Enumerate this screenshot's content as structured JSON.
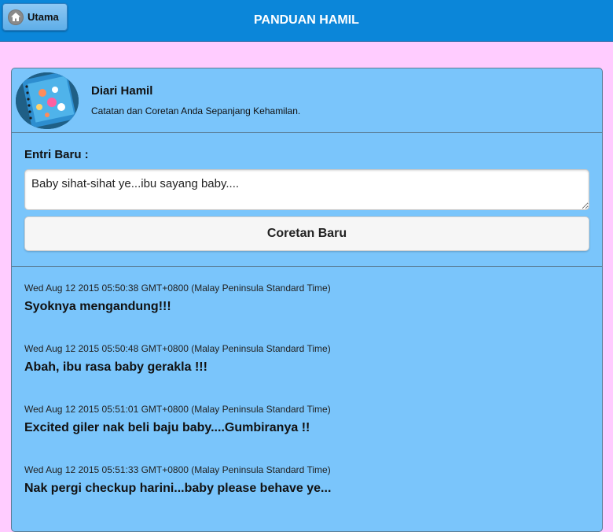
{
  "header": {
    "home_label": "Utama",
    "title": "PANDUAN HAMIL"
  },
  "diary": {
    "title": "Diari Hamil",
    "subtitle": "Catatan dan Coretan Anda Sepanjang Kehamilan."
  },
  "new_entry": {
    "label": "Entri Baru :",
    "value": "Baby sihat-sihat ye...ibu sayang baby....",
    "button_label": "Coretan Baru"
  },
  "entries": [
    {
      "time": "Wed Aug 12 2015 05:50:38 GMT+0800 (Malay Peninsula Standard Time)",
      "text": "Syoknya mengandung!!!"
    },
    {
      "time": "Wed Aug 12 2015 05:50:48 GMT+0800 (Malay Peninsula Standard Time)",
      "text": "Abah, ibu rasa baby gerakla !!!"
    },
    {
      "time": "Wed Aug 12 2015 05:51:01 GMT+0800 (Malay Peninsula Standard Time)",
      "text": "Excited giler nak beli baju baby....Gumbiranya !!"
    },
    {
      "time": "Wed Aug 12 2015 05:51:33 GMT+0800 (Malay Peninsula Standard Time)",
      "text": "Nak pergi checkup harini...baby please behave ye..."
    }
  ],
  "colors": {
    "header": "#0b86d9",
    "page_background": "#ffccff",
    "panel": "#7ac5fb"
  },
  "icons": {
    "home": "home-icon",
    "avatar": "diary-notebook-image"
  }
}
